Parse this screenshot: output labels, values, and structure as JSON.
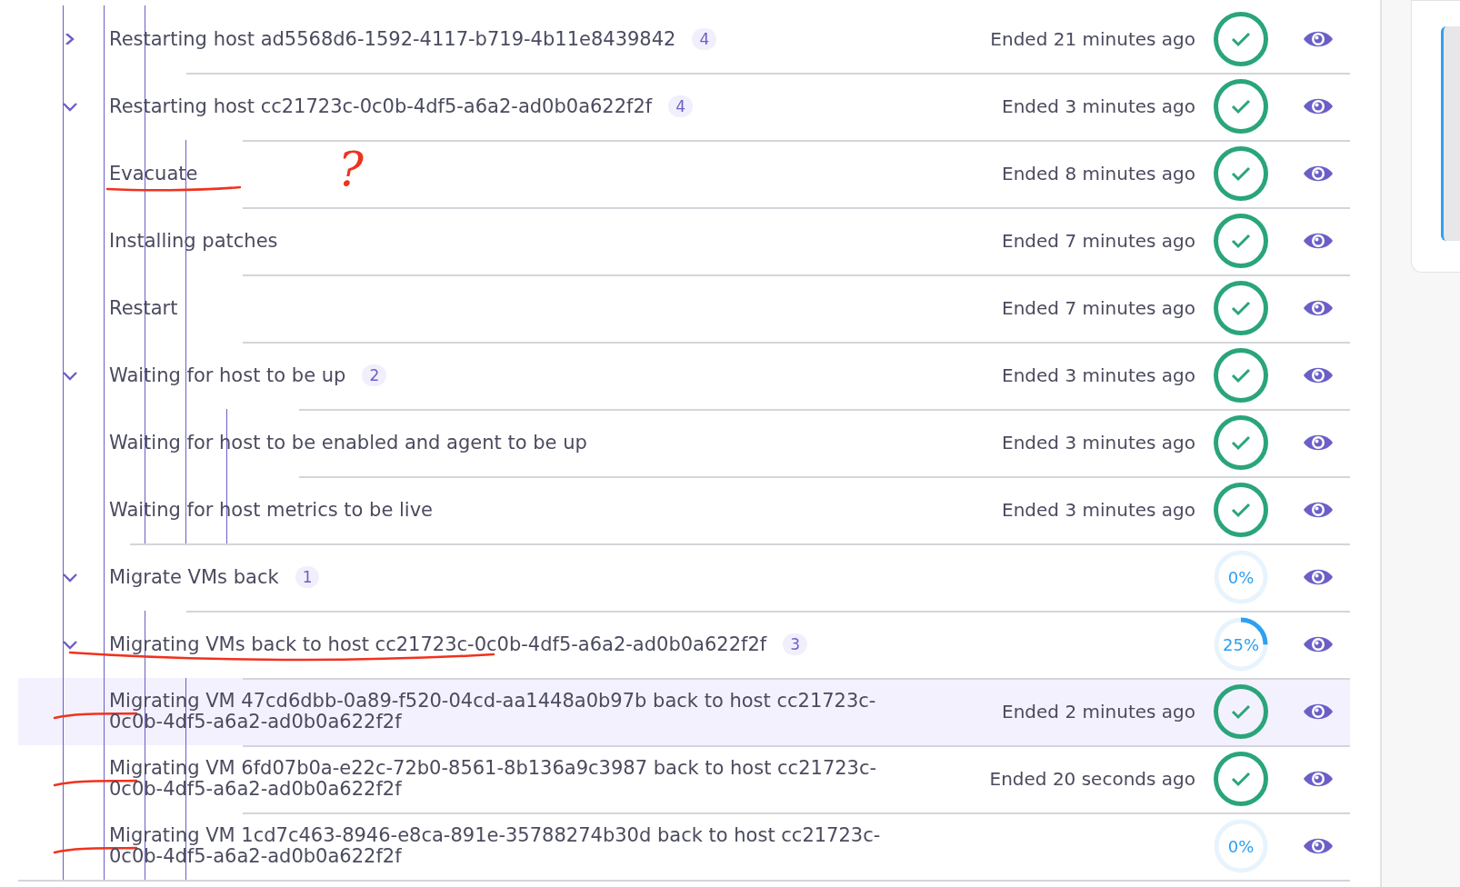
{
  "task_list": {
    "continued_subtasks": [
      {
        "label": "Restarting host ad5568d6-1592-4117-b719-4b11e8439842",
        "count": "4",
        "expanded": false,
        "selected": false,
        "time": "Ended 21 minutes ago",
        "status": {
          "kind": "done"
        }
      },
      {
        "label": "Restarting host cc21723c-0c0b-4df5-a6a2-ad0b0a622f2f",
        "count": "4",
        "expanded": true,
        "selected": false,
        "time": "Ended 3 minutes ago",
        "status": {
          "kind": "done"
        },
        "children": [
          {
            "label": "Evacuate",
            "selected": false,
            "time": "Ended 8 minutes ago",
            "status": {
              "kind": "done"
            },
            "annotation": {
              "kind": "underline",
              "note": "?"
            }
          },
          {
            "label": "Installing patches",
            "selected": false,
            "time": "Ended 7 minutes ago",
            "status": {
              "kind": "done"
            }
          },
          {
            "label": "Restart",
            "selected": false,
            "time": "Ended 7 minutes ago",
            "status": {
              "kind": "done"
            }
          },
          {
            "label": "Waiting for host to be up",
            "count": "2",
            "expanded": true,
            "selected": false,
            "time": "Ended 3 minutes ago",
            "status": {
              "kind": "done"
            },
            "children": [
              {
                "label": "Waiting for host to be enabled and agent to be up",
                "selected": false,
                "time": "Ended 3 minutes ago",
                "status": {
                  "kind": "done"
                }
              },
              {
                "label": "Waiting for host metrics to be live",
                "selected": false,
                "time": "Ended 3 minutes ago",
                "status": {
                  "kind": "done"
                }
              }
            ]
          }
        ]
      }
    ],
    "tasks": [
      {
        "label": "Migrate VMs back",
        "count": "1",
        "expanded": true,
        "selected": false,
        "status": {
          "kind": "progress",
          "level": 0,
          "label": "0%"
        },
        "children": [
          {
            "label": "Migrating VMs back to host cc21723c-0c0b-4df5-a6a2-ad0b0a622f2f",
            "count": "3",
            "expanded": true,
            "selected": false,
            "status": {
              "kind": "progress",
              "level": 0.25,
              "label": "25%"
            },
            "annotation": {
              "kind": "long-underline"
            },
            "children": [
              {
                "label": "Migrating VM 47cd6dbb-0a89-f520-04cd-aa1448a0b97b back to host cc21723c-0c0b-4df5-a6a2-ad0b0a622f2f",
                "selected": true,
                "time": "Ended 2 minutes ago",
                "status": {
                  "kind": "done"
                },
                "annotation": {
                  "kind": "dash"
                }
              },
              {
                "label": "Migrating VM 6fd07b0a-e22c-72b0-8561-8b136a9c3987 back to host cc21723c-0c0b-4df5-a6a2-ad0b0a622f2f",
                "selected": false,
                "time": "Ended 20 seconds ago",
                "status": {
                  "kind": "done"
                },
                "annotation": {
                  "kind": "dash"
                }
              },
              {
                "label": "Migrating VM 1cd7c463-8946-e8ca-891e-35788274b30d back to host cc21723c-0c0b-4df5-a6a2-ad0b0a622f2f",
                "selected": false,
                "status": {
                  "kind": "progress",
                  "level": 0,
                  "label": "0%"
                },
                "annotation": {
                  "kind": "dash"
                }
              }
            ]
          }
        ]
      }
    ]
  }
}
